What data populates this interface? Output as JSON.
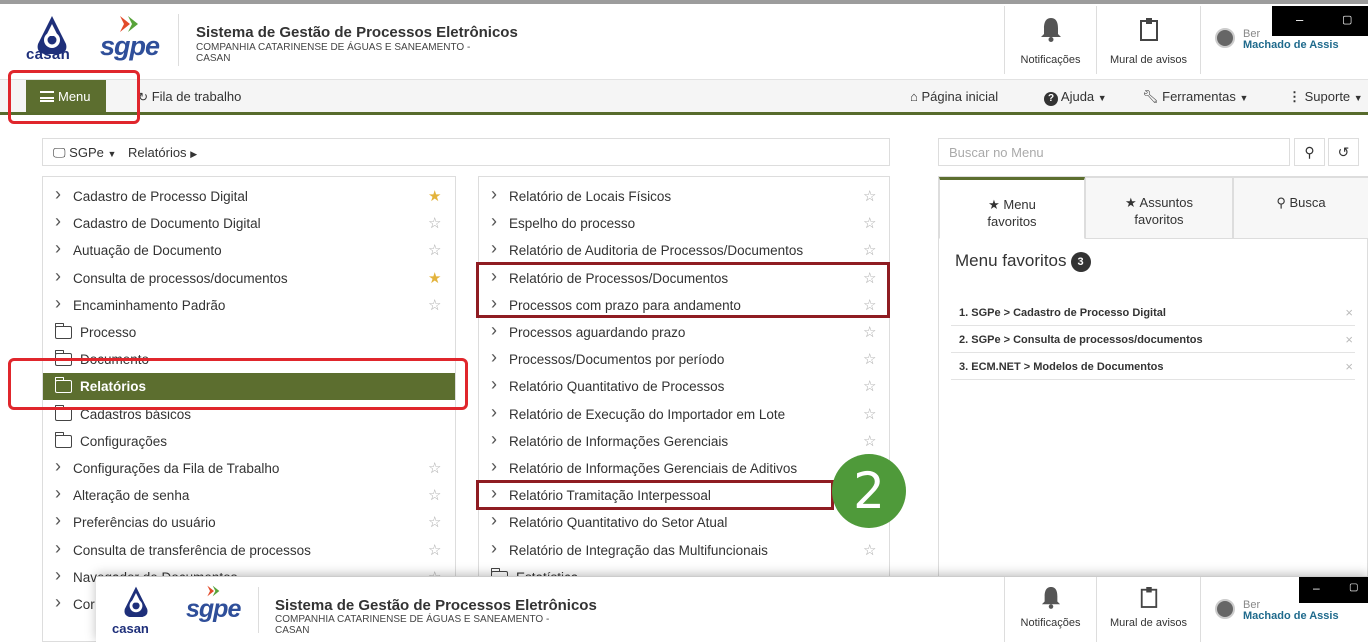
{
  "header": {
    "logo_casan_text": "casan",
    "logo_sgpe_text": "sgpe",
    "title": "Sistema de Gestão de Processos Eletrônicos",
    "org_line1": "COMPANHIA CATARINENSE DE ÁGUAS E SANEAMENTO -",
    "org_line2": "CASAN",
    "notifications_label": "Notificações",
    "board_label": "Mural de avisos",
    "user_name_1": "Ber",
    "user_name_2": "Machado de Assis",
    "window_minimize": "–",
    "window_restore": "▢"
  },
  "navbar": {
    "menu_label": "Menu",
    "worklist_label": "Fila de trabalho",
    "home_label": "Página inicial",
    "help_label": "Ajuda",
    "tools_label": "Ferramentas",
    "support_label": "Suporte"
  },
  "breadcrumb": {
    "root": "SGPe",
    "current": "Relatórios"
  },
  "search": {
    "placeholder": "Buscar no Menu"
  },
  "left_menu": {
    "items": [
      {
        "label": "Cadastro de Processo Digital",
        "type": "link",
        "favorite": true
      },
      {
        "label": "Cadastro de Documento Digital",
        "type": "link",
        "favorite": false
      },
      {
        "label": "Autuação de Documento",
        "type": "link",
        "favorite": false
      },
      {
        "label": "Consulta de processos/documentos",
        "type": "link",
        "favorite": true
      },
      {
        "label": "Encaminhamento Padrão",
        "type": "link",
        "favorite": false
      },
      {
        "label": "Processo",
        "type": "folder"
      },
      {
        "label": "Documento",
        "type": "folder"
      },
      {
        "label": "Relatórios",
        "type": "folder",
        "active": true
      },
      {
        "label": "Cadastros básicos",
        "type": "folder"
      },
      {
        "label": "Configurações",
        "type": "folder"
      },
      {
        "label": "Configurações da Fila de Trabalho",
        "type": "link",
        "favorite": false
      },
      {
        "label": "Alteração de senha",
        "type": "link",
        "favorite": false
      },
      {
        "label": "Preferências do usuário",
        "type": "link",
        "favorite": false
      },
      {
        "label": "Consulta de transferência de processos",
        "type": "link",
        "favorite": false
      },
      {
        "label": "Navegador de Documentos",
        "type": "link",
        "favorite": false
      },
      {
        "label": "Cor",
        "type": "link",
        "favorite": false
      }
    ]
  },
  "reports_menu": {
    "items": [
      {
        "label": "Relatório de Locais Físicos",
        "star": true
      },
      {
        "label": "Espelho do processo",
        "star": true
      },
      {
        "label": "Relatório de Auditoria de Processos/Documentos",
        "star": true
      },
      {
        "label": "Relatório de Processos/Documentos",
        "star": true
      },
      {
        "label": "Processos com prazo para andamento",
        "star": true
      },
      {
        "label": "Processos aguardando prazo",
        "star": true
      },
      {
        "label": "Processos/Documentos por período",
        "star": true
      },
      {
        "label": "Relatório Quantitativo de Processos",
        "star": true
      },
      {
        "label": "Relatório de Execução do Importador em Lote",
        "star": true
      },
      {
        "label": "Relatório de Informações Gerenciais",
        "star": true
      },
      {
        "label": "Relatório de Informações Gerenciais de Aditivos",
        "star": false
      },
      {
        "label": "Relatório Tramitação Interpessoal",
        "star": false
      },
      {
        "label": "Relatório Quantitativo do Setor Atual",
        "star": false
      },
      {
        "label": "Relatório de Integração das Multifuncionais",
        "star": true
      }
    ],
    "folder_label": "Estatística"
  },
  "favorites_panel": {
    "tab_menu_line1": "Menu",
    "tab_menu_line2": "favoritos",
    "tab_subjects_line1": "Assuntos",
    "tab_subjects_line2": "favoritos",
    "tab_search": "Busca",
    "title": "Menu favoritos",
    "count": "3",
    "items": [
      "1. SGPe > Cadastro de Processo Digital",
      "2. SGPe > Consulta de processos/documentos",
      "3. ECM.NET > Modelos de Documentos"
    ]
  },
  "annotation": {
    "step_number": "2"
  },
  "colors": {
    "brand_green": "#5c6e2f",
    "highlight_red": "#e0262c",
    "badge_green": "#4f9a3a"
  }
}
